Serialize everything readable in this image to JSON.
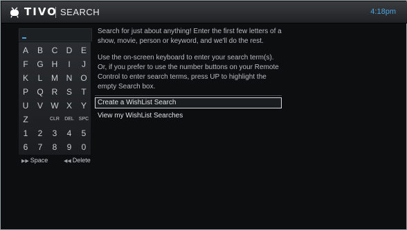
{
  "header": {
    "brand": "TIVO",
    "title": "SEARCH",
    "clock": "4:18pm",
    "logo_icon": "tivo-logo-icon"
  },
  "search": {
    "value": ""
  },
  "keyboard": {
    "rows": [
      [
        "A",
        "B",
        "C",
        "D",
        "E"
      ],
      [
        "F",
        "G",
        "H",
        "I",
        "J"
      ],
      [
        "K",
        "L",
        "M",
        "N",
        "O"
      ],
      [
        "P",
        "Q",
        "R",
        "S",
        "T"
      ],
      [
        "U",
        "V",
        "W",
        "X",
        "Y"
      ],
      [
        "Z",
        "CLR",
        "DEL",
        "SPC"
      ],
      [
        "1",
        "2",
        "3",
        "4",
        "5"
      ],
      [
        "6",
        "7",
        "8",
        "9",
        "0"
      ]
    ]
  },
  "hints": {
    "space": "Space",
    "space_icon": "fast-forward-icon",
    "delete": "Delete",
    "delete_icon": "rewind-icon"
  },
  "instructions": {
    "line1": "Search for just about anything! Enter the first few letters of a show, movie, person or keyword, and we'll do the rest.",
    "line2": "Use the on-screen keyboard to enter your search term(s). Or, if you prefer to use the number buttons on your Remote Control to enter search terms, press UP to highlight the empty Search box."
  },
  "menu": [
    {
      "label": "Create a WishList Search",
      "selected": true
    },
    {
      "label": "View my WishList Searches",
      "selected": false
    }
  ],
  "colors": {
    "accent": "#4aa3df",
    "background": "#0d0e10"
  }
}
